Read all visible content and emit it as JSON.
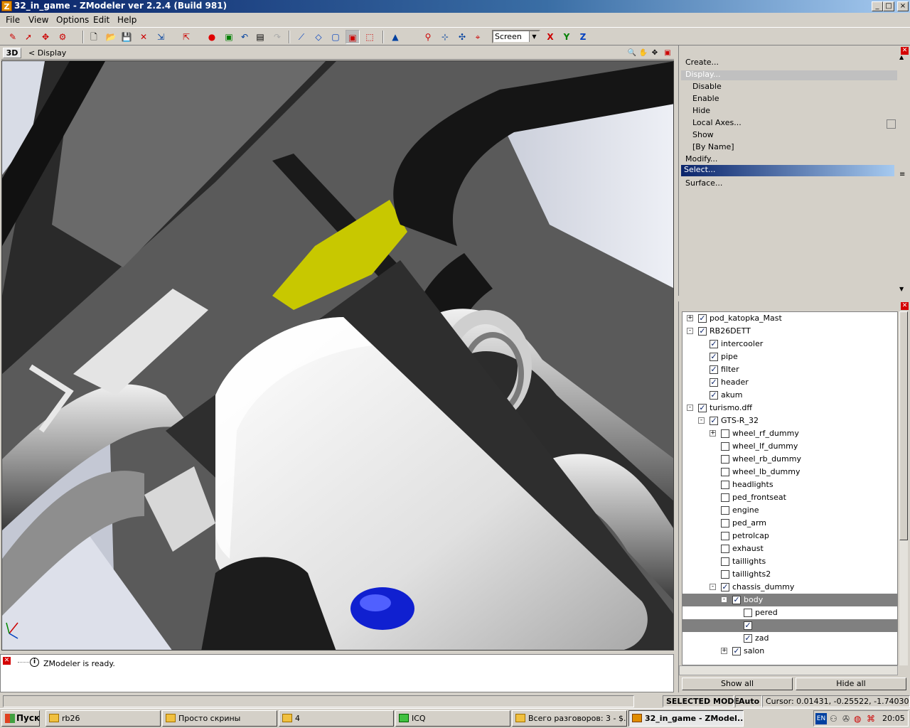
{
  "window": {
    "title": "32_in_game - ZModeler ver 2.2.4 (Build 981)",
    "app_icon": "Z",
    "controls": [
      "_",
      "□",
      "×"
    ]
  },
  "menu": [
    "File",
    "View",
    "Options",
    "Edit",
    "Help"
  ],
  "toolbar": {
    "view_select": "Screen",
    "axis_x": "X",
    "axis_y": "Y",
    "axis_z": "Z"
  },
  "viewport": {
    "mode": "3D",
    "breadcrumb": "<  Display"
  },
  "commands": {
    "create": "Create...",
    "display": "Display...",
    "disable": "Disable",
    "enable": "Enable",
    "hide": "Hide",
    "local_axes": "Local Axes...",
    "show": "Show",
    "by_name": "[By Name]",
    "modify": "Modify...",
    "select": "Select...",
    "surface": "Surface..."
  },
  "tree": [
    {
      "label": "pod_katopka_Mast",
      "checked": true,
      "level": 0,
      "expander": "+"
    },
    {
      "label": "RB26DETT",
      "checked": true,
      "level": 0,
      "expander": "-"
    },
    {
      "label": "intercooler",
      "checked": true,
      "level": 1,
      "expander": ""
    },
    {
      "label": "pipe",
      "checked": true,
      "level": 1,
      "expander": ""
    },
    {
      "label": "filter",
      "checked": true,
      "level": 1,
      "expander": ""
    },
    {
      "label": "header",
      "checked": true,
      "level": 1,
      "expander": ""
    },
    {
      "label": "akum",
      "checked": true,
      "level": 1,
      "expander": ""
    },
    {
      "label": "turismo.dff",
      "checked": true,
      "level": 0,
      "expander": "-"
    },
    {
      "label": "GTS-R_32",
      "checked": true,
      "level": 1,
      "expander": "-"
    },
    {
      "label": "wheel_rf_dummy",
      "checked": false,
      "level": 2,
      "expander": "+"
    },
    {
      "label": "wheel_lf_dummy",
      "checked": false,
      "level": 2,
      "expander": ""
    },
    {
      "label": "wheel_rb_dummy",
      "checked": false,
      "level": 2,
      "expander": ""
    },
    {
      "label": "wheel_lb_dummy",
      "checked": false,
      "level": 2,
      "expander": ""
    },
    {
      "label": "headlights",
      "checked": false,
      "level": 2,
      "expander": ""
    },
    {
      "label": "ped_frontseat",
      "checked": false,
      "level": 2,
      "expander": ""
    },
    {
      "label": "engine",
      "checked": false,
      "level": 2,
      "expander": ""
    },
    {
      "label": "ped_arm",
      "checked": false,
      "level": 2,
      "expander": ""
    },
    {
      "label": "petrolcap",
      "checked": false,
      "level": 2,
      "expander": ""
    },
    {
      "label": "exhaust",
      "checked": false,
      "level": 2,
      "expander": ""
    },
    {
      "label": "taillights",
      "checked": false,
      "level": 2,
      "expander": ""
    },
    {
      "label": "taillights2",
      "checked": false,
      "level": 2,
      "expander": ""
    },
    {
      "label": "chassis_dummy",
      "checked": true,
      "level": 2,
      "expander": "-"
    },
    {
      "label": "body",
      "checked": true,
      "level": 3,
      "expander": "-",
      "selected": true
    },
    {
      "label": "pered",
      "checked": false,
      "level": 4,
      "expander": ""
    },
    {
      "label": "",
      "checked": true,
      "level": 4,
      "expander": "",
      "selected": true
    },
    {
      "label": "zad",
      "checked": true,
      "level": 4,
      "expander": ""
    },
    {
      "label": "salon",
      "checked": true,
      "level": 3,
      "expander": "+"
    }
  ],
  "buttons": {
    "show_all": "Show all",
    "hide_all": "Hide all"
  },
  "log": {
    "message": "ZModeler is ready."
  },
  "status": {
    "mode": "SELECTED MODE",
    "auto": "Auto",
    "cursor": "Cursor: 0.01431, -0.25522, -1.74030"
  },
  "taskbar": {
    "start": "Пуск",
    "tasks": [
      "rb26",
      "Просто скрины",
      "4",
      "ICQ",
      "Всего разговоров: 3 - $...",
      "32_in_game - ZModel..."
    ],
    "tray_lang": "EN",
    "clock": "20:05"
  }
}
